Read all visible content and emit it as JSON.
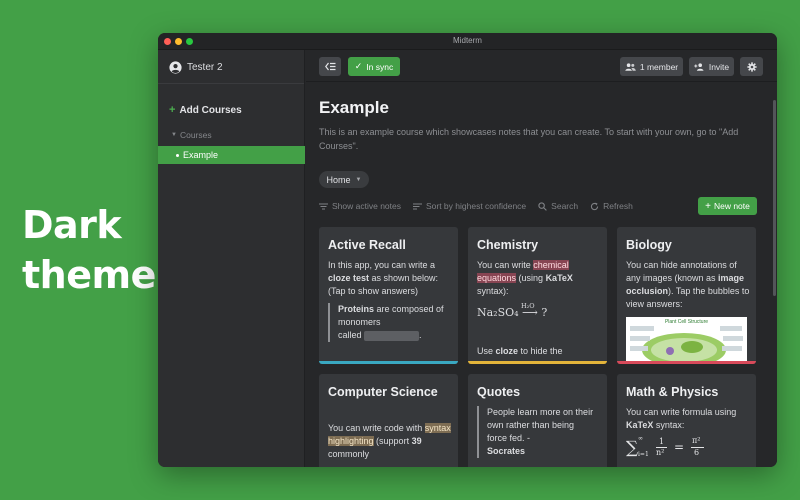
{
  "promo": {
    "line1": "Dark",
    "line2": "theme"
  },
  "window": {
    "title": "Midterm"
  },
  "sidebar": {
    "user_name": "Tester 2",
    "add_courses_label": "Add Courses",
    "courses_header": "Courses",
    "courses": [
      {
        "label": "Example",
        "selected": true
      }
    ]
  },
  "toolbar": {
    "sync_label": "In sync",
    "members_label": "1 member",
    "invite_label": "Invite"
  },
  "course": {
    "title": "Example",
    "description": "This is an example course which showcases notes that you can create. To start with your own, go to \"Add Courses\".",
    "filter_value": "Home"
  },
  "actions": {
    "show_active": "Show active notes",
    "sort": "Sort by highest confidence",
    "search": "Search",
    "refresh": "Refresh",
    "new_note": "New note"
  },
  "cards": [
    {
      "title": "Active Recall",
      "p1_a": "In this app, you can write a ",
      "p1_bold": "cloze test",
      "p1_b": " as shown below: (Tap to show answers)",
      "q_bold": "Proteins",
      "q_a": " are composed of monomers",
      "q_b": "called ",
      "q_end": ".",
      "accent": "#3aa8c1"
    },
    {
      "title": "Chemistry",
      "p1_a": "You can write ",
      "p1_hl": "chemical equations",
      "p1_b": " (using ",
      "p1_bold": "KaTeX",
      "p1_c": " syntax):",
      "formula": "Na₂SO₄ ⟶ ?",
      "arrow_label": "H₂O",
      "p2_a": "Use ",
      "p2_bold": "cloze",
      "p2_b": " to hide the",
      "accent": "#e3b43a"
    },
    {
      "title": "Biology",
      "p1_a": "You can hide annotations of any images (known as ",
      "p1_bold": "image occlusion",
      "p1_b": "). Tap the bubbles to view answers:",
      "image_caption": "Plant Cell Structure",
      "accent": "#d84a5a"
    },
    {
      "title": "Computer Science",
      "p1_a": "You can write code with ",
      "p1_hl": "syntax highlighting",
      "p1_b": " (support ",
      "p1_bold": "39",
      "p1_c": " commonly"
    },
    {
      "title": "Quotes",
      "quote_text": "People learn more on their own rather than being force fed. -",
      "quote_author": "Socrates"
    },
    {
      "title": "Math & Physics",
      "p1_a": "You can write formula using ",
      "p1_bold": "KaTeX",
      "p1_b": " syntax:",
      "formula": "∑ 1/n² = π²/6",
      "formula_sum": "∑",
      "formula_upper": "∞",
      "formula_lower": "i=1",
      "formula_num": "1",
      "formula_den": "n²",
      "formula_eq": "=",
      "formula_rnum": "π²",
      "formula_rden": "6"
    }
  ],
  "colors": {
    "accent": "#43a047",
    "background": "#262729",
    "card": "#36383b"
  }
}
